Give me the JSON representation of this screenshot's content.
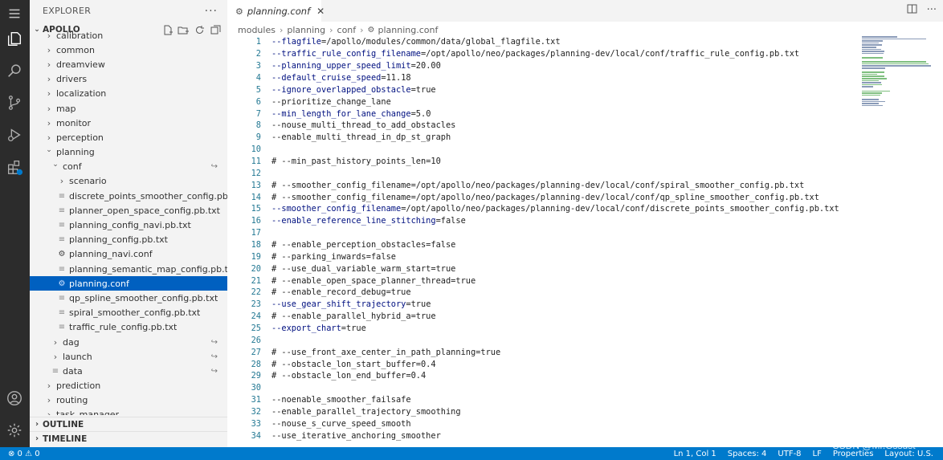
{
  "sidebar": {
    "title": "EXPLORER",
    "more_label": "···",
    "project": "APOLLO",
    "tree": [
      {
        "label": "calibration",
        "depth": 1,
        "type": "folder",
        "open": false
      },
      {
        "label": "common",
        "depth": 1,
        "type": "folder",
        "open": false
      },
      {
        "label": "dreamview",
        "depth": 1,
        "type": "folder",
        "open": false
      },
      {
        "label": "drivers",
        "depth": 1,
        "type": "folder",
        "open": false
      },
      {
        "label": "localization",
        "depth": 1,
        "type": "folder",
        "open": false
      },
      {
        "label": "map",
        "depth": 1,
        "type": "folder",
        "open": false
      },
      {
        "label": "monitor",
        "depth": 1,
        "type": "folder",
        "open": false
      },
      {
        "label": "perception",
        "depth": 1,
        "type": "folder",
        "open": false
      },
      {
        "label": "planning",
        "depth": 1,
        "type": "folder",
        "open": true
      },
      {
        "label": "conf",
        "depth": 2,
        "type": "folder",
        "open": true,
        "link": true
      },
      {
        "label": "scenario",
        "depth": 3,
        "type": "folder",
        "open": false
      },
      {
        "label": "discrete_points_smoother_config.pb.txt",
        "depth": 3,
        "type": "txt"
      },
      {
        "label": "planner_open_space_config.pb.txt",
        "depth": 3,
        "type": "txt"
      },
      {
        "label": "planning_config_navi.pb.txt",
        "depth": 3,
        "type": "txt"
      },
      {
        "label": "planning_config.pb.txt",
        "depth": 3,
        "type": "txt"
      },
      {
        "label": "planning_navi.conf",
        "depth": 3,
        "type": "conf"
      },
      {
        "label": "planning_semantic_map_config.pb.txt",
        "depth": 3,
        "type": "txt"
      },
      {
        "label": "planning.conf",
        "depth": 3,
        "type": "conf",
        "selected": true
      },
      {
        "label": "qp_spline_smoother_config.pb.txt",
        "depth": 3,
        "type": "txt"
      },
      {
        "label": "spiral_smoother_config.pb.txt",
        "depth": 3,
        "type": "txt"
      },
      {
        "label": "traffic_rule_config.pb.txt",
        "depth": 3,
        "type": "txt"
      },
      {
        "label": "dag",
        "depth": 2,
        "type": "folder",
        "open": false,
        "link": true
      },
      {
        "label": "launch",
        "depth": 2,
        "type": "folder",
        "open": false,
        "link": true
      },
      {
        "label": "data",
        "depth": 2,
        "type": "txt",
        "link": true
      },
      {
        "label": "prediction",
        "depth": 1,
        "type": "folder",
        "open": false
      },
      {
        "label": "routing",
        "depth": 1,
        "type": "folder",
        "open": false
      },
      {
        "label": "task_manager",
        "depth": 1,
        "type": "folder",
        "open": false
      }
    ],
    "outline_label": "OUTLINE",
    "timeline_label": "TIMELINE"
  },
  "editor": {
    "tab_label": "planning.conf",
    "breadcrumb": [
      "modules",
      "planning",
      "conf",
      "planning.conf"
    ],
    "lines": [
      {
        "n": "1",
        "kind": "flag",
        "key": "--flagfile",
        "val": "=/apollo/modules/common/data/global_flagfile.txt"
      },
      {
        "n": "2",
        "kind": "flag",
        "key": "--traffic_rule_config_filename",
        "val": "=/opt/apollo/neo/packages/planning-dev/local/conf/traffic_rule_config.pb.txt"
      },
      {
        "n": "3",
        "kind": "flag",
        "key": "--planning_upper_speed_limit",
        "val": "=20.00"
      },
      {
        "n": "4",
        "kind": "flag",
        "key": "--default_cruise_speed",
        "val": "=11.18"
      },
      {
        "n": "5",
        "kind": "flag",
        "key": "--ignore_overlapped_obstacle",
        "val": "=true"
      },
      {
        "n": "6",
        "kind": "plain",
        "text": "--prioritize_change_lane"
      },
      {
        "n": "7",
        "kind": "flag",
        "key": "--min_length_for_lane_change",
        "val": "=5.0"
      },
      {
        "n": "8",
        "kind": "plain",
        "text": "--nouse_multi_thread_to_add_obstacles"
      },
      {
        "n": "9",
        "kind": "plain",
        "text": "--enable_multi_thread_in_dp_st_graph"
      },
      {
        "n": "10",
        "kind": "plain",
        "text": ""
      },
      {
        "n": "11",
        "kind": "comment",
        "text": "# --min_past_history_points_len=10"
      },
      {
        "n": "12",
        "kind": "plain",
        "text": ""
      },
      {
        "n": "13",
        "kind": "comment",
        "text": "# --smoother_config_filename=/opt/apollo/neo/packages/planning-dev/local/conf/spiral_smoother_config.pb.txt"
      },
      {
        "n": "14",
        "kind": "comment",
        "text": "# --smoother_config_filename=/opt/apollo/neo/packages/planning-dev/local/conf/qp_spline_smoother_config.pb.txt"
      },
      {
        "n": "15",
        "kind": "flag",
        "key": "--smoother_config_filename",
        "val": "=/opt/apollo/neo/packages/planning-dev/local/conf/discrete_points_smoother_config.pb.txt"
      },
      {
        "n": "16",
        "kind": "flag",
        "key": "--enable_reference_line_stitching",
        "val": "=false"
      },
      {
        "n": "17",
        "kind": "plain",
        "text": ""
      },
      {
        "n": "18",
        "kind": "comment",
        "text": "# --enable_perception_obstacles=false"
      },
      {
        "n": "19",
        "kind": "comment",
        "text": "# --parking_inwards=false"
      },
      {
        "n": "20",
        "kind": "comment",
        "text": "# --use_dual_variable_warm_start=true"
      },
      {
        "n": "21",
        "kind": "comment",
        "text": "# --enable_open_space_planner_thread=true"
      },
      {
        "n": "22",
        "kind": "comment",
        "text": "# --enable_record_debug=true"
      },
      {
        "n": "23",
        "kind": "flag",
        "key": "--use_gear_shift_trajectory",
        "val": "=true"
      },
      {
        "n": "24",
        "kind": "comment",
        "text": "# --enable_parallel_hybrid_a=true"
      },
      {
        "n": "25",
        "kind": "flag",
        "key": "--export_chart",
        "val": "=true"
      },
      {
        "n": "26",
        "kind": "plain",
        "text": ""
      },
      {
        "n": "27",
        "kind": "comment",
        "text": "# --use_front_axe_center_in_path_planning=true"
      },
      {
        "n": "28",
        "kind": "comment",
        "text": "# --obstacle_lon_start_buffer=0.4"
      },
      {
        "n": "29",
        "kind": "comment",
        "text": "# --obstacle_lon_end_buffer=0.4"
      },
      {
        "n": "30",
        "kind": "plain",
        "text": ""
      },
      {
        "n": "31",
        "kind": "plain",
        "text": "--noenable_smoother_failsafe"
      },
      {
        "n": "32",
        "kind": "plain",
        "text": "--enable_parallel_trajectory_smoothing"
      },
      {
        "n": "33",
        "kind": "plain",
        "text": "--nouse_s_curve_speed_smooth"
      },
      {
        "n": "34",
        "kind": "plain",
        "text": "--use_iterative_anchoring_smoother"
      }
    ]
  },
  "status": {
    "problems": "⊗ 0 ⚠ 0",
    "position": "Ln 1, Col 1",
    "spaces": "Spaces: 4",
    "encoding": "UTF-8",
    "eol": "LF",
    "properties": "Properties",
    "layout": "Layout: U.S."
  },
  "watermark": "CSDN @Mr.Gssust",
  "colors": {
    "activity_bar": "#2c2c2c",
    "sidebar": "#f3f3f3",
    "selection": "#0060c0",
    "status_bar": "#007acc",
    "comment": "#008000",
    "flag_key": "#001080",
    "line_number": "#237893"
  }
}
